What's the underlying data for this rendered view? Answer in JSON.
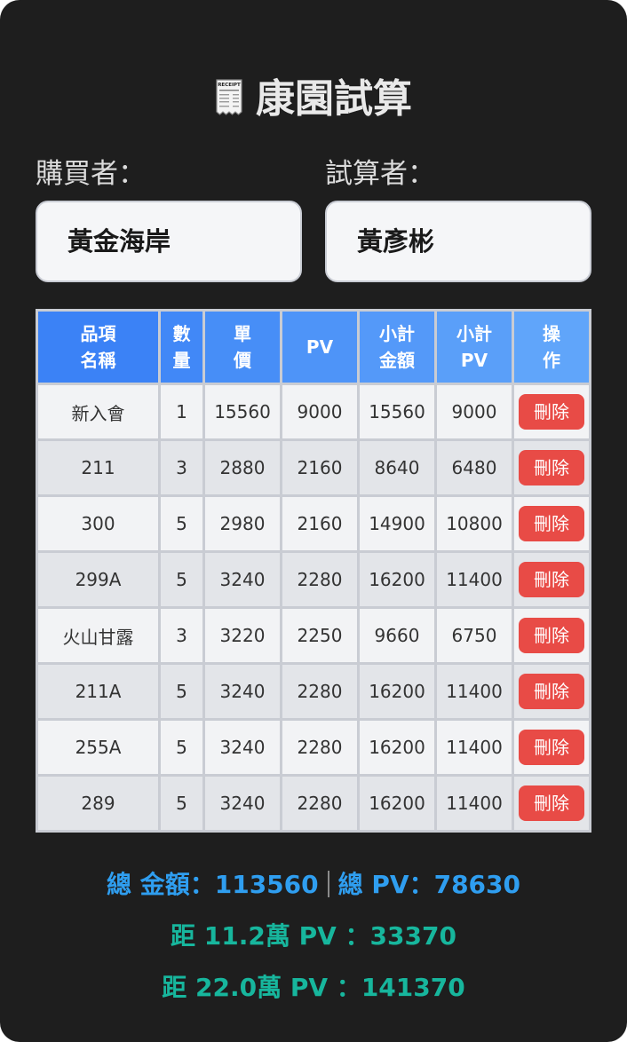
{
  "header": {
    "title": "康園試算",
    "icon": "receipt-icon",
    "icon_text": "RECEIPT"
  },
  "buyer": {
    "label": "購買者：",
    "value": "黃金海岸"
  },
  "calculator": {
    "label": "試算者：",
    "value": "黃彥彬"
  },
  "table": {
    "headers": [
      {
        "line1": "品項",
        "line2": "名稱"
      },
      {
        "line1": "數",
        "line2": "量"
      },
      {
        "line1": "單",
        "line2": "價"
      },
      {
        "line1": "PV",
        "line2": ""
      },
      {
        "line1": "小計",
        "line2": "金額"
      },
      {
        "line1": "小計",
        "line2": "PV"
      },
      {
        "line1": "操",
        "line2": "作"
      }
    ],
    "rows": [
      {
        "name": "新入會",
        "qty": "1",
        "price": "15560",
        "pv": "9000",
        "subtotal": "15560",
        "subtotal_pv": "9000",
        "action": "刪除"
      },
      {
        "name": "211",
        "qty": "3",
        "price": "2880",
        "pv": "2160",
        "subtotal": "8640",
        "subtotal_pv": "6480",
        "action": "刪除"
      },
      {
        "name": "300",
        "qty": "5",
        "price": "2980",
        "pv": "2160",
        "subtotal": "14900",
        "subtotal_pv": "10800",
        "action": "刪除"
      },
      {
        "name": "299A",
        "qty": "5",
        "price": "3240",
        "pv": "2280",
        "subtotal": "16200",
        "subtotal_pv": "11400",
        "action": "刪除"
      },
      {
        "name": "火山甘露",
        "qty": "3",
        "price": "3220",
        "pv": "2250",
        "subtotal": "9660",
        "subtotal_pv": "6750",
        "action": "刪除"
      },
      {
        "name": "211A",
        "qty": "5",
        "price": "3240",
        "pv": "2280",
        "subtotal": "16200",
        "subtotal_pv": "11400",
        "action": "刪除"
      },
      {
        "name": "255A",
        "qty": "5",
        "price": "3240",
        "pv": "2280",
        "subtotal": "16200",
        "subtotal_pv": "11400",
        "action": "刪除"
      },
      {
        "name": "289",
        "qty": "5",
        "price": "3240",
        "pv": "2280",
        "subtotal": "16200",
        "subtotal_pv": "11400",
        "action": "刪除"
      }
    ]
  },
  "summary": {
    "total_amount_label": "總 金額：",
    "total_amount": "113560",
    "total_pv_label": "總 PV：",
    "total_pv": "78630",
    "gap1_label": "距 11.2萬 PV ：",
    "gap1_value": "33370",
    "gap2_label": "距 22.0萬 PV ：",
    "gap2_value": "141370"
  },
  "colors": {
    "background": "#1e1e1e",
    "header_gradient_start": "#3b82f6",
    "header_gradient_end": "#60a5fa",
    "delete_button": "#e84b46",
    "total_text": "#2f9ef0",
    "gap_text": "#17b69d"
  }
}
